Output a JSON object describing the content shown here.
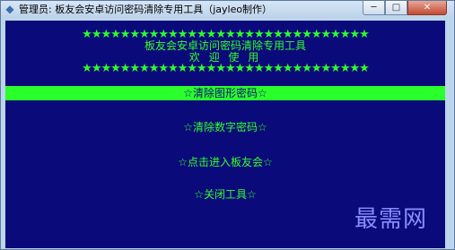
{
  "window": {
    "title": "管理员: 板友会安卓访问密码清除专用工具（jayleo制作）",
    "icon": "app-icon",
    "controls": {
      "minimize": "─",
      "maximize": "□",
      "close": "✕"
    }
  },
  "header": {
    "stars": "★★★★★★★★★★★★★★★★★★★★★★★★★★★★★★",
    "line1": "板友会安卓访问密码清除专用工具",
    "line2": "欢 迎 使 用"
  },
  "menu": {
    "items": [
      {
        "label": "☆清除图形密码☆",
        "selected": true
      },
      {
        "label": "☆清除数字密码☆",
        "selected": false
      },
      {
        "label": "☆点击进入板友会☆",
        "selected": false
      },
      {
        "label": "☆关闭工具☆",
        "selected": false
      }
    ]
  },
  "watermark": "最需网",
  "colors": {
    "background": "#0a0a7a",
    "text": "#2bff2b",
    "highlight": "#2bff2b"
  }
}
